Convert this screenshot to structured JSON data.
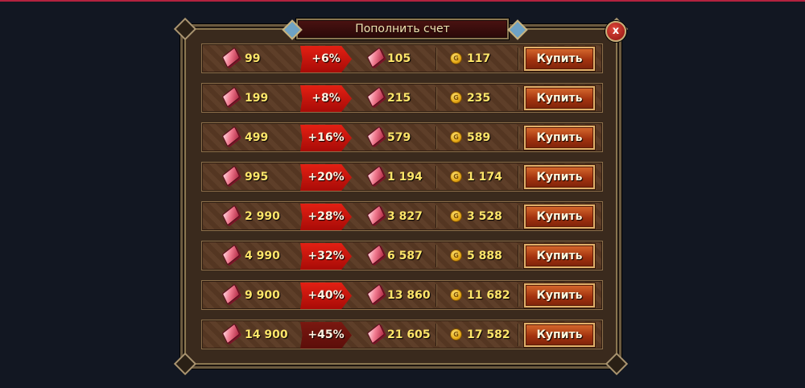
{
  "dialog": {
    "title": "Пополнить счет",
    "close_label": "x"
  },
  "currency": {
    "coin_symbol": "G"
  },
  "offers": [
    {
      "price": "99",
      "bonus": "+6%",
      "crystals": "105",
      "gold": "117",
      "buy_label": "Купить"
    },
    {
      "price": "199",
      "bonus": "+8%",
      "crystals": "215",
      "gold": "235",
      "buy_label": "Купить"
    },
    {
      "price": "499",
      "bonus": "+16%",
      "crystals": "579",
      "gold": "589",
      "buy_label": "Купить"
    },
    {
      "price": "995",
      "bonus": "+20%",
      "crystals": "1 194",
      "gold": "1 174",
      "buy_label": "Купить"
    },
    {
      "price": "2 990",
      "bonus": "+28%",
      "crystals": "3 827",
      "gold": "3 528",
      "buy_label": "Купить"
    },
    {
      "price": "4 990",
      "bonus": "+32%",
      "crystals": "6 587",
      "gold": "5 888",
      "buy_label": "Купить"
    },
    {
      "price": "9 900",
      "bonus": "+40%",
      "crystals": "13 860",
      "gold": "11 682",
      "buy_label": "Купить"
    },
    {
      "price": "14 900",
      "bonus": "+45%",
      "crystals": "21 605",
      "gold": "17 582",
      "buy_label": "Купить"
    }
  ],
  "colors": {
    "background": "#121722",
    "accent_line": "#b3223f",
    "value_text": "#ffe66a",
    "bonus_red": "#d41a10",
    "button": "#a3330f"
  }
}
